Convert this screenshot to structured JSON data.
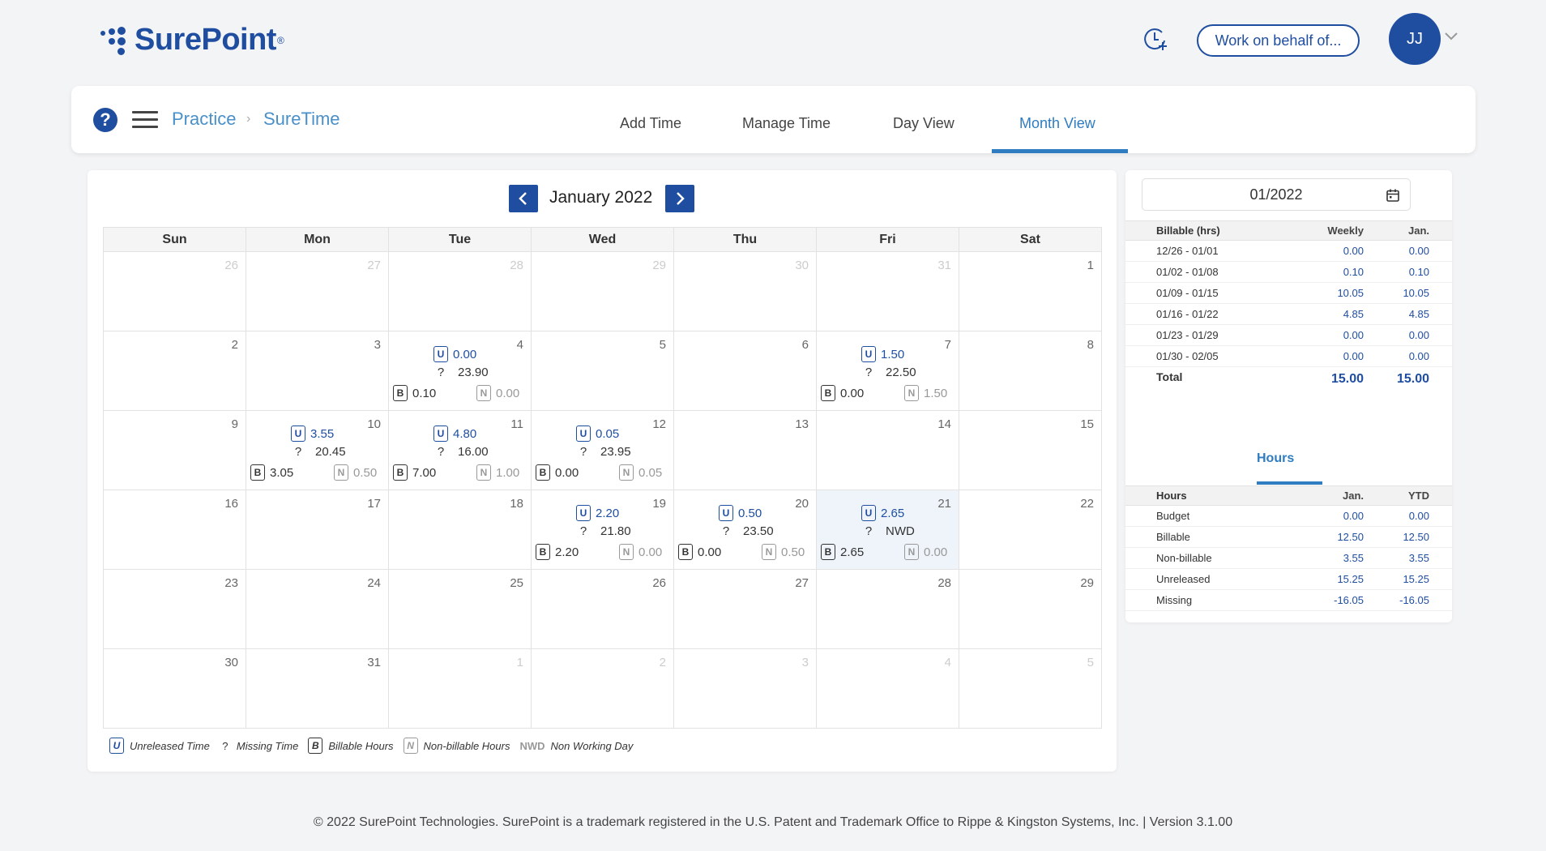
{
  "header": {
    "logo_text": "SurePoint",
    "logo_tm": "®",
    "behalf_button": "Work on behalf of...",
    "avatar_initials": "JJ",
    "brand_color": "#1f4ea1"
  },
  "nav": {
    "breadcrumb": [
      "Practice",
      "SureTime"
    ],
    "tabs": [
      "Add Time",
      "Manage Time",
      "Day View",
      "Month View"
    ],
    "active_tab": "Month View"
  },
  "calendar": {
    "month_label": "January 2022",
    "weekdays": [
      "Sun",
      "Mon",
      "Tue",
      "Wed",
      "Thu",
      "Fri",
      "Sat"
    ],
    "weeks": [
      [
        {
          "d": "26",
          "other": true
        },
        {
          "d": "27",
          "other": true
        },
        {
          "d": "28",
          "other": true
        },
        {
          "d": "29",
          "other": true
        },
        {
          "d": "30",
          "other": true
        },
        {
          "d": "31",
          "other": true
        },
        {
          "d": "1"
        }
      ],
      [
        {
          "d": "2"
        },
        {
          "d": "3"
        },
        {
          "d": "4",
          "u": "0.00",
          "q": "23.90",
          "b": "0.10",
          "n": "0.00"
        },
        {
          "d": "5"
        },
        {
          "d": "6"
        },
        {
          "d": "7",
          "u": "1.50",
          "q": "22.50",
          "b": "0.00",
          "n": "1.50"
        },
        {
          "d": "8"
        }
      ],
      [
        {
          "d": "9"
        },
        {
          "d": "10",
          "u": "3.55",
          "q": "20.45",
          "b": "3.05",
          "n": "0.50"
        },
        {
          "d": "11",
          "u": "4.80",
          "q": "16.00",
          "b": "7.00",
          "n": "1.00"
        },
        {
          "d": "12",
          "u": "0.05",
          "q": "23.95",
          "b": "0.00",
          "n": "0.05"
        },
        {
          "d": "13"
        },
        {
          "d": "14"
        },
        {
          "d": "15"
        }
      ],
      [
        {
          "d": "16"
        },
        {
          "d": "17"
        },
        {
          "d": "18"
        },
        {
          "d": "19",
          "u": "2.20",
          "q": "21.80",
          "b": "2.20",
          "n": "0.00"
        },
        {
          "d": "20",
          "u": "0.50",
          "q": "23.50",
          "b": "0.00",
          "n": "0.50"
        },
        {
          "d": "21",
          "u": "2.65",
          "q": "NWD",
          "b": "2.65",
          "n": "0.00",
          "highlight": true
        },
        {
          "d": "22"
        }
      ],
      [
        {
          "d": "23"
        },
        {
          "d": "24"
        },
        {
          "d": "25"
        },
        {
          "d": "26"
        },
        {
          "d": "27"
        },
        {
          "d": "28"
        },
        {
          "d": "29"
        }
      ],
      [
        {
          "d": "30"
        },
        {
          "d": "31"
        },
        {
          "d": "1",
          "other": true
        },
        {
          "d": "2",
          "other": true
        },
        {
          "d": "3",
          "other": true
        },
        {
          "d": "4",
          "other": true
        },
        {
          "d": "5",
          "other": true
        }
      ]
    ],
    "legend": {
      "u_badge": "U",
      "u_label": "Unreleased Time",
      "q_badge": "?",
      "q_label": "Missing Time",
      "b_badge": "B",
      "b_label": "Billable Hours",
      "n_badge": "N",
      "n_label": "Non-billable Hours",
      "nwd_badge": "NWD",
      "nwd_label": "Non Working Day"
    }
  },
  "side": {
    "date_value": "01/2022",
    "billable_table": {
      "headers": [
        "Billable (hrs)",
        "Weekly",
        "Jan."
      ],
      "rows": [
        [
          "12/26 - 01/01",
          "0.00",
          "0.00"
        ],
        [
          "01/02 - 01/08",
          "0.10",
          "0.10"
        ],
        [
          "01/09 - 01/15",
          "10.05",
          "10.05"
        ],
        [
          "01/16 - 01/22",
          "4.85",
          "4.85"
        ],
        [
          "01/23 - 01/29",
          "0.00",
          "0.00"
        ],
        [
          "01/30 - 02/05",
          "0.00",
          "0.00"
        ]
      ],
      "total": [
        "Total",
        "15.00",
        "15.00"
      ]
    },
    "hours_tab": "Hours",
    "hours_table": {
      "headers": [
        "Hours",
        "Jan.",
        "YTD"
      ],
      "rows": [
        [
          "Budget",
          "0.00",
          "0.00"
        ],
        [
          "Billable",
          "12.50",
          "12.50"
        ],
        [
          "Non-billable",
          "3.55",
          "3.55"
        ],
        [
          "Unreleased",
          "15.25",
          "15.25"
        ],
        [
          "Missing",
          "-16.05",
          "-16.05"
        ]
      ]
    }
  },
  "footer": "© 2022 SurePoint Technologies. SurePoint is a trademark registered in the U.S. Patent and Trademark Office to Rippe & Kingston Systems, Inc. | Version 3.1.00"
}
